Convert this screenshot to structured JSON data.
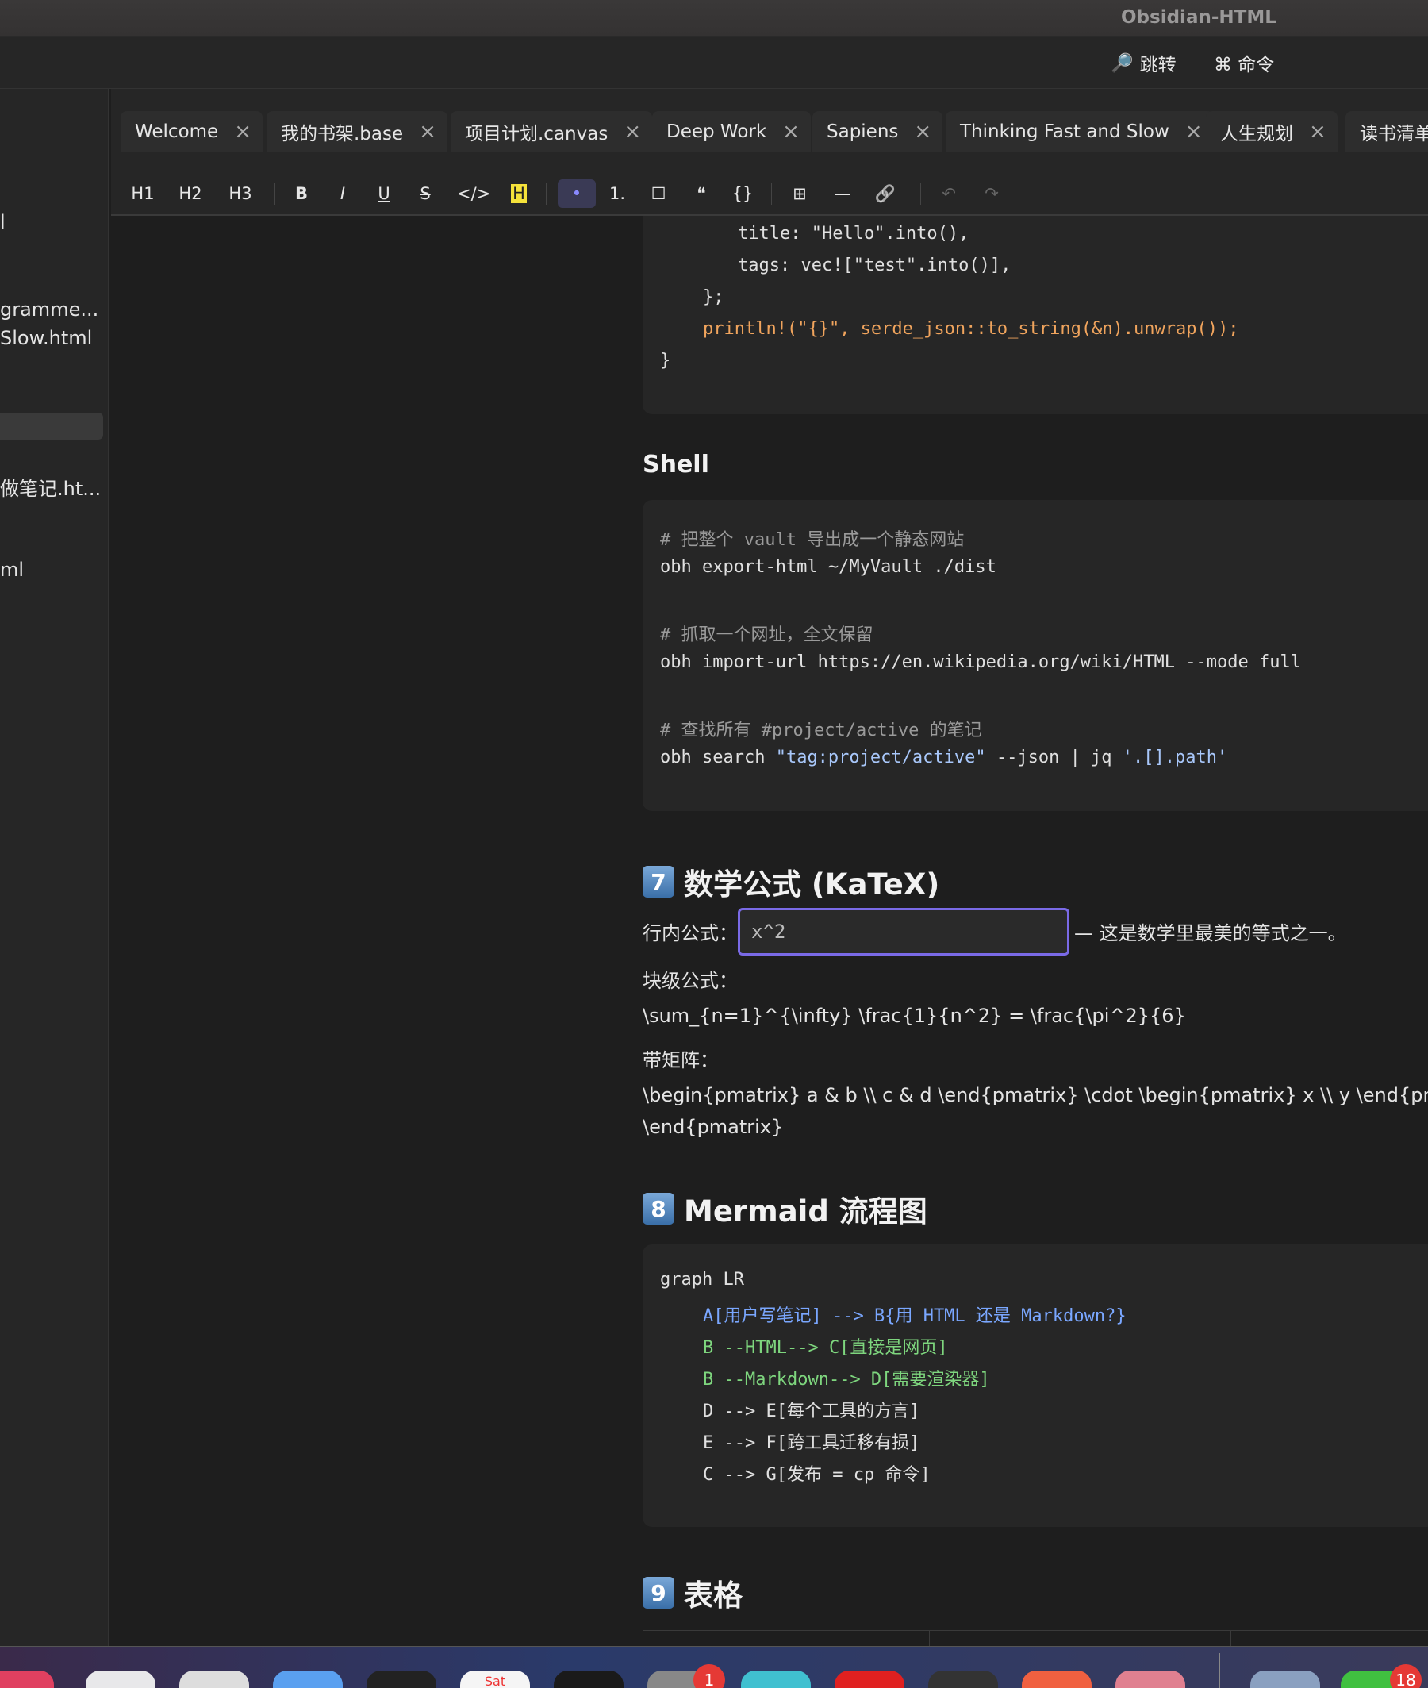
{
  "window": {
    "title": "Obsidian-HTML"
  },
  "commands": {
    "jump": "跳转",
    "command": "⌘ 命令"
  },
  "sidebar": {
    "files": [
      "l",
      "gramme...",
      "Slow.html",
      "做笔记.ht...",
      "ml"
    ]
  },
  "tabs": [
    {
      "label": "Welcome"
    },
    {
      "label": "我的书架.base"
    },
    {
      "label": "项目计划.canvas"
    },
    {
      "label": "Deep Work"
    },
    {
      "label": "Sapiens"
    },
    {
      "label": "Thinking Fast and Slow"
    },
    {
      "label": "人生规划"
    },
    {
      "label": "读书清单"
    }
  ],
  "toolbar": {
    "h1": "H1",
    "h2": "H2",
    "h3": "H3",
    "bold": "B",
    "italic": "I",
    "underline": "U",
    "strike": "S",
    "code": "</>",
    "highlight": "H",
    "bullet": "•",
    "numbered": "1.",
    "checkbox": "☐",
    "quote": "❝",
    "codeblock": "{}",
    "table": "⊞",
    "hr": "—",
    "link": "🔗",
    "undo": "↶",
    "redo": "↷"
  },
  "rust_code": {
    "l1": "title: \"Hello\".into(),",
    "l2": "tags: vec![\"test\".into()],",
    "l3": "};",
    "l4": "println!(\"{}\", serde_json::to_string(&n).unwrap());",
    "l5": "}"
  },
  "shell": {
    "heading": "Shell",
    "c1": "# 把整个 vault 导出成一个静态网站",
    "l1": "obh export-html ~/MyVault ./dist",
    "c2": "# 抓取一个网址，全文保留",
    "l2": "obh import-url https://en.wikipedia.org/wiki/HTML --mode full",
    "c3": "# 查找所有 #project/active 的笔记",
    "l3a": "obh search ",
    "l3b": "\"tag:project/active\"",
    "l3c": " --json | jq ",
    "l3d": "'.[].path'"
  },
  "math": {
    "heading_num": "7",
    "heading": "数学公式 (KaTeX)",
    "inline_label": "行内公式：",
    "inline_value": "x^2",
    "inline_after": "— 这是数学里最美的等式之一。",
    "block_label": "块级公式：",
    "block_formula": "\\sum_{n=1}^{\\infty} \\frac{1}{n^2} = \\frac{\\pi^2}{6}",
    "matrix_label": "带矩阵：",
    "matrix_line1": "\\begin{pmatrix} a & b \\\\ c & d \\end{pmatrix} \\cdot \\begin{pmatrix} x \\\\ y \\end{pmatrix} = \\b",
    "matrix_line2": "\\end{pmatrix}"
  },
  "mermaid": {
    "heading_num": "8",
    "heading": "Mermaid 流程图",
    "lines": [
      "graph LR",
      "A[用户写笔记] --> B{用 HTML 还是 Markdown?}",
      "B --HTML--> C[直接是网页]",
      "B --Markdown--> D[需要渲染器]",
      "D --> E[每个工具的方言]",
      "E --> F[跨工具迁移有损]",
      "C --> G[发布 = cp 命令]"
    ]
  },
  "table_section": {
    "heading_num": "9",
    "heading": "表格"
  },
  "dock": {
    "badge1": "1",
    "badge2": "18",
    "calendar_label": "Sat"
  }
}
